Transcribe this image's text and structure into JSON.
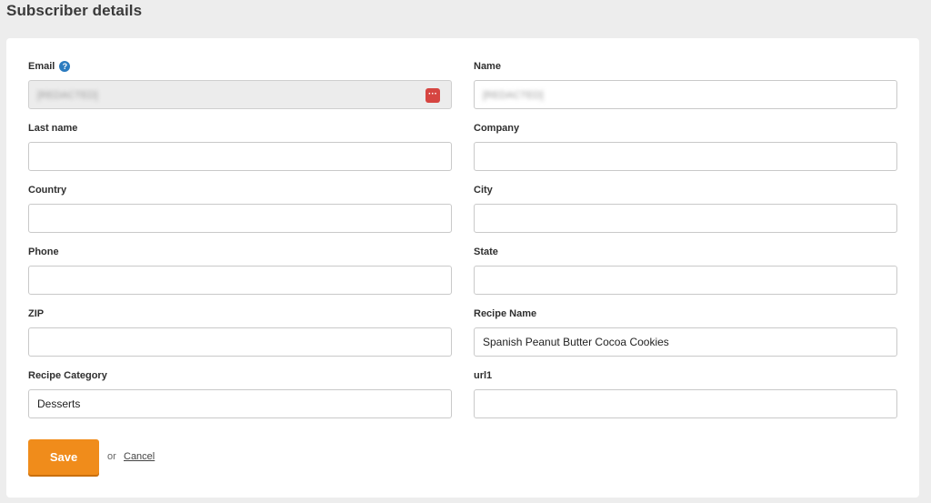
{
  "page": {
    "title": "Subscriber details"
  },
  "form": {
    "email": {
      "label": "Email",
      "value": "[REDACTED]",
      "help_icon": "question-circle-icon",
      "action_icon": "password-manager-icon"
    },
    "name": {
      "label": "Name",
      "value": "[REDACTED]"
    },
    "last_name": {
      "label": "Last name",
      "value": ""
    },
    "company": {
      "label": "Company",
      "value": ""
    },
    "country": {
      "label": "Country",
      "value": ""
    },
    "city": {
      "label": "City",
      "value": ""
    },
    "phone": {
      "label": "Phone",
      "value": ""
    },
    "state": {
      "label": "State",
      "value": ""
    },
    "zip": {
      "label": "ZIP",
      "value": ""
    },
    "recipe_name": {
      "label": "Recipe Name",
      "value": "Spanish Peanut Butter Cocoa Cookies"
    },
    "recipe_category": {
      "label": "Recipe Category",
      "value": "Desserts"
    },
    "url1": {
      "label": "url1",
      "value": ""
    }
  },
  "actions": {
    "save_label": "Save",
    "or_text": "or",
    "cancel_label": "Cancel"
  },
  "colors": {
    "accent": "#f08c1b",
    "help": "#2b7bbf",
    "keyicon": "#d64541"
  }
}
